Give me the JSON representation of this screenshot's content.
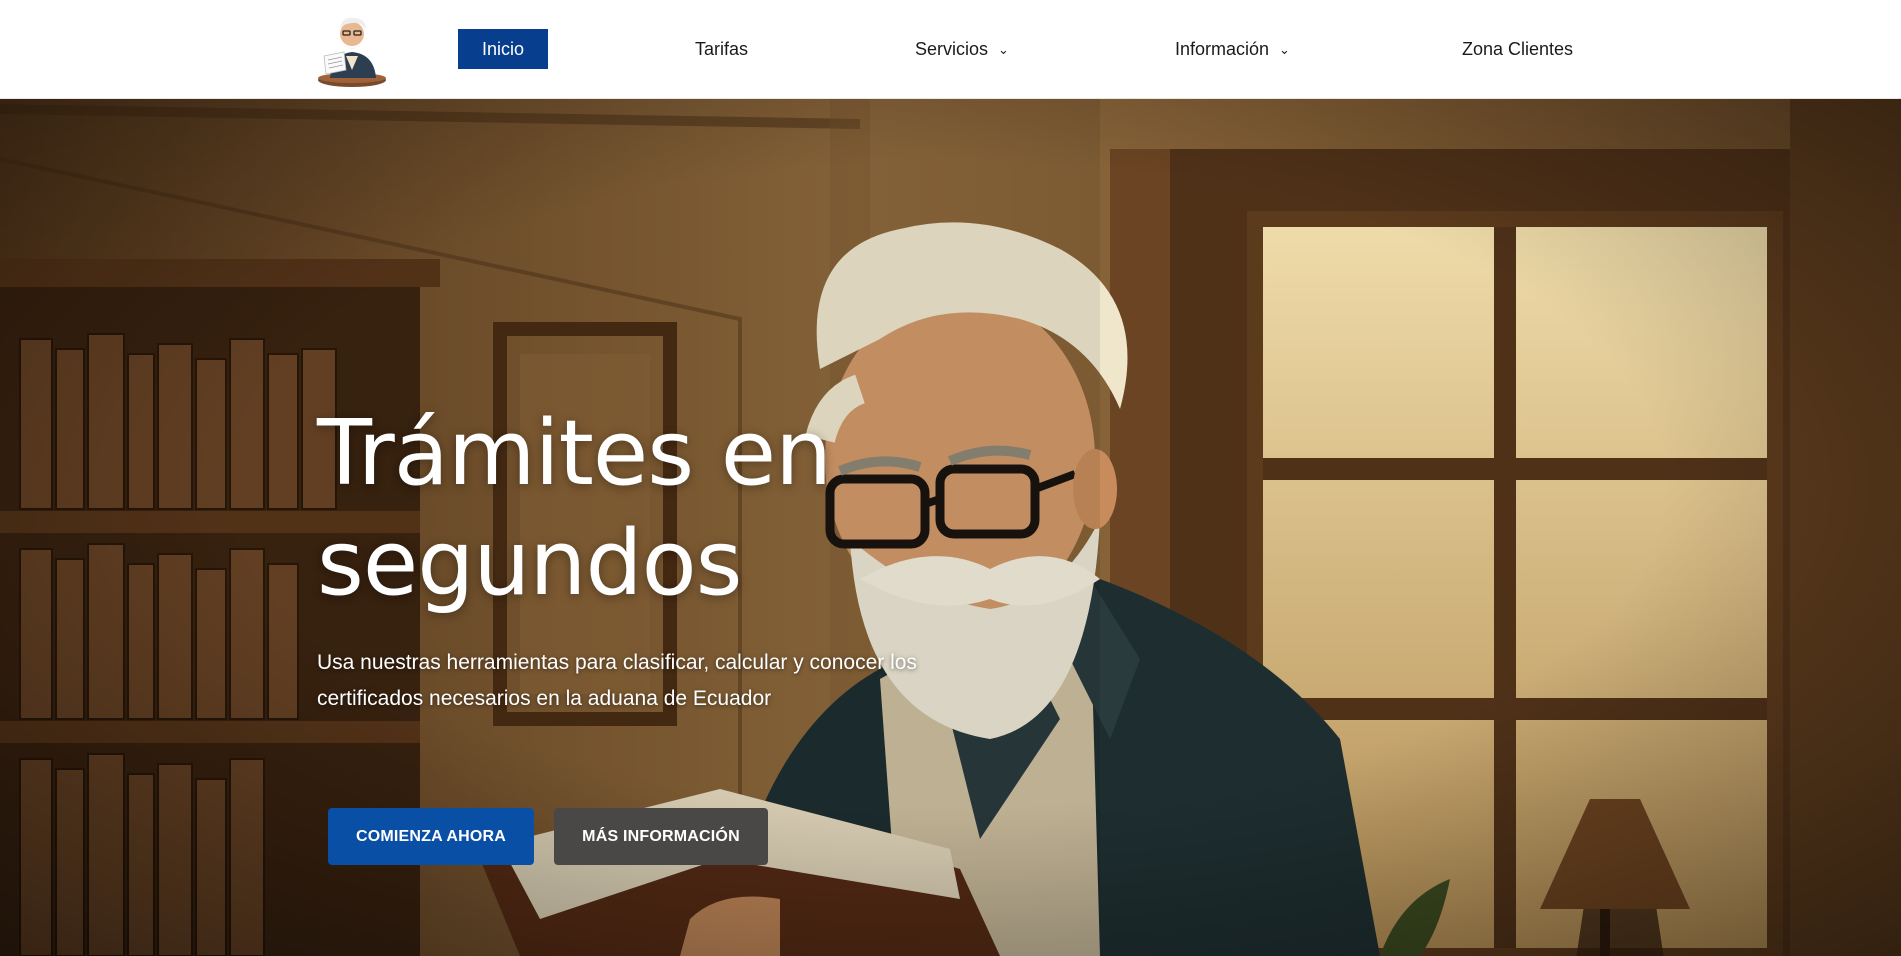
{
  "header": {
    "logo_alt": "Logo",
    "nav": [
      {
        "label": "Inicio",
        "active": true,
        "dropdown": false
      },
      {
        "label": "Tarifas",
        "active": false,
        "dropdown": false
      },
      {
        "label": "Servicios",
        "active": false,
        "dropdown": true
      },
      {
        "label": "Información",
        "active": false,
        "dropdown": true
      },
      {
        "label": "Zona Clientes",
        "active": false,
        "dropdown": false
      }
    ]
  },
  "hero": {
    "title_line1": "Trámites en",
    "title_line2": "segundos",
    "subtitle_line1": "Usa nuestras herramientas para clasificar, calcular y conocer los",
    "subtitle_line2": "certificados necesarios en la aduana de Ecuador",
    "primary_cta": "COMIENZA AHORA",
    "secondary_cta": "MÁS INFORMACIÓN"
  },
  "icons": {
    "chevron": "chevron-down-icon"
  },
  "colors": {
    "accent": "#073f8e",
    "primary_button": "#0a4fa6",
    "secondary_button": "#4a4847"
  }
}
